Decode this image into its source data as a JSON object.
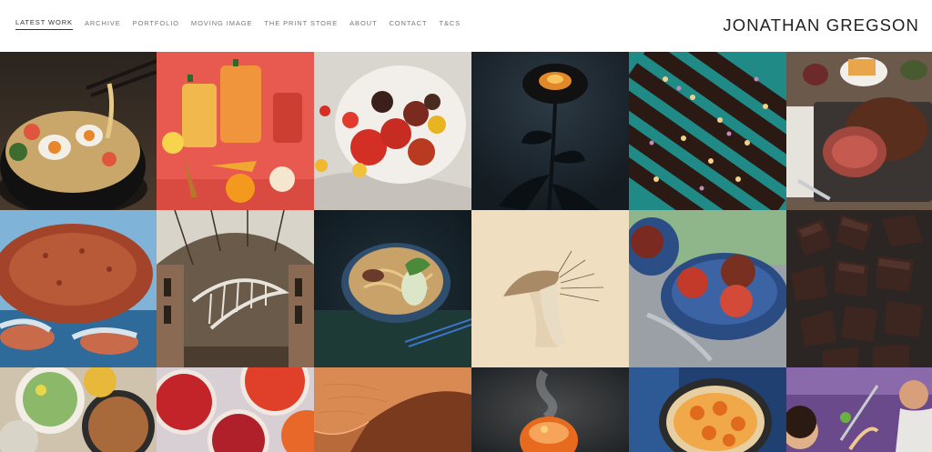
{
  "site": {
    "title": "JONATHAN GREGSON"
  },
  "nav": {
    "items": [
      {
        "label": "LATEST WORK",
        "active": true
      },
      {
        "label": "ARCHIVE"
      },
      {
        "label": "PORTFOLIO"
      },
      {
        "label": "MOVING IMAGE"
      },
      {
        "label": "THE PRINT STORE"
      },
      {
        "label": "ABOUT"
      },
      {
        "label": "CONTACT"
      },
      {
        "label": "T&CS"
      }
    ]
  },
  "gallery": {
    "tiles": [
      {
        "icon": "ramen-bowl-photo"
      },
      {
        "icon": "tea-glasses-photo"
      },
      {
        "icon": "tomatoes-plate-photo"
      },
      {
        "icon": "dark-flower-photo"
      },
      {
        "icon": "chocolate-bark-photo"
      },
      {
        "icon": "roast-beef-photo"
      },
      {
        "icon": "crab-photo"
      },
      {
        "icon": "museum-skeleton-photo"
      },
      {
        "icon": "noodle-bowl-photo"
      },
      {
        "icon": "mushroom-acupuncture-photo"
      },
      {
        "icon": "sorbet-bowl-photo"
      },
      {
        "icon": "chocolate-pieces-photo"
      },
      {
        "icon": "salad-spread-photo"
      },
      {
        "icon": "blood-orange-photo"
      },
      {
        "icon": "sand-dune-photo"
      },
      {
        "icon": "steaming-dish-photo"
      },
      {
        "icon": "tart-dish-photo"
      },
      {
        "icon": "family-cooking-photo"
      }
    ]
  },
  "colors": {
    "nav_text": "#777777",
    "nav_active": "#333333",
    "title": "#222222"
  }
}
